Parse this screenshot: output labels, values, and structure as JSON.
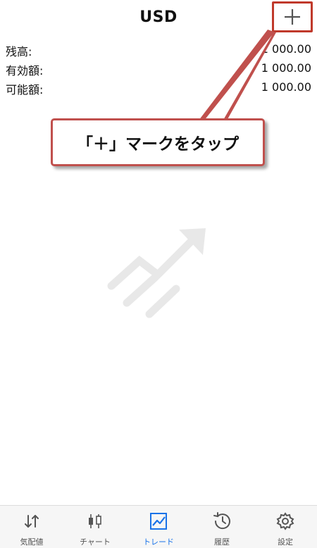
{
  "header": {
    "title": "USD"
  },
  "account": {
    "rows": [
      {
        "label": "残高:",
        "value": "1 000.00"
      },
      {
        "label": "有効額:",
        "value": "1 000.00"
      },
      {
        "label": "可能額:",
        "value": "1 000.00"
      }
    ]
  },
  "callout": {
    "text": "「＋」マークをタップ"
  },
  "tabs": [
    {
      "label": "気配値",
      "icon": "quotes-arrows-icon",
      "active": false
    },
    {
      "label": "チャート",
      "icon": "candlestick-chart-icon",
      "active": false
    },
    {
      "label": "トレード",
      "icon": "trade-chart-icon",
      "active": true
    },
    {
      "label": "履歴",
      "icon": "history-icon",
      "active": false
    },
    {
      "label": "設定",
      "icon": "settings-gear-icon",
      "active": false
    }
  ],
  "colors": {
    "highlight": "#c0392b",
    "active_tab": "#1a73e8",
    "watermark": "#e8e8e8"
  }
}
